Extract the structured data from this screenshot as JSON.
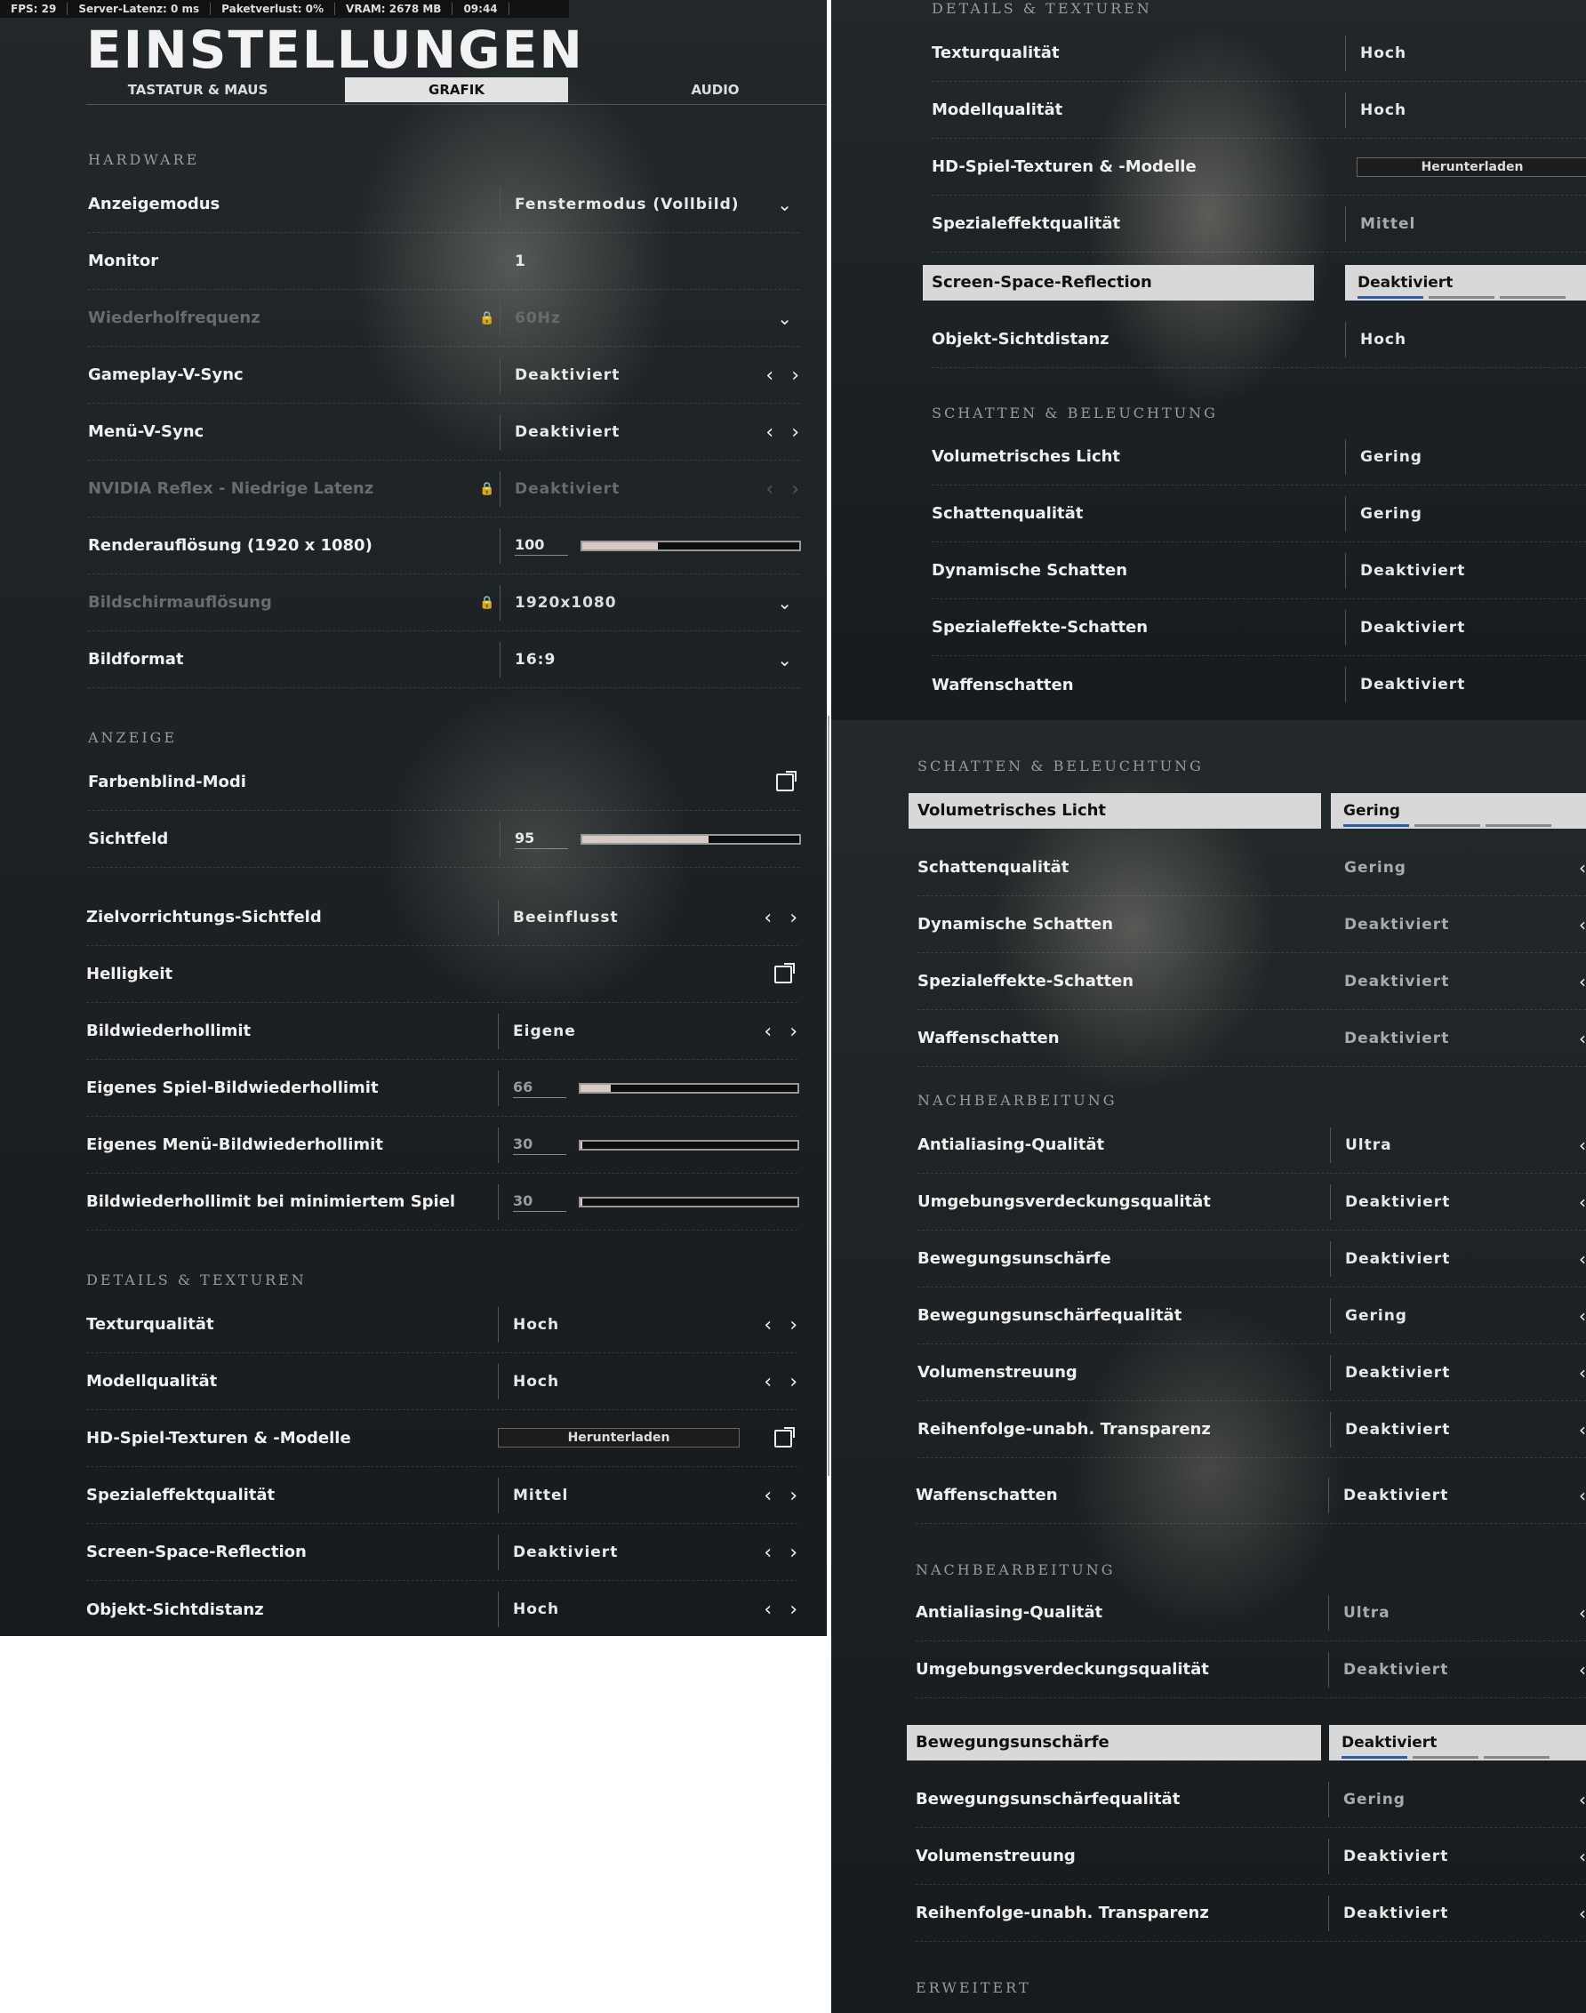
{
  "status": {
    "fps": "FPS: 29",
    "latency": "Server-Latenz: 0 ms",
    "packet": "Paketverlust: 0%",
    "vram": "VRAM: 2678 MB",
    "time": "09:44"
  },
  "header": {
    "title": "EINSTELLUNGEN",
    "tabs": [
      "TASTATUR & MAUS",
      "GRAFIK",
      "AUDIO"
    ],
    "active_tab": "GRAFIK"
  },
  "p1": {
    "hardware": "HARDWARE",
    "anzeigemodus": {
      "label": "Anzeigemodus",
      "value": "Fenstermodus (Vollbild)"
    },
    "monitor": {
      "label": "Monitor",
      "value": "1"
    },
    "wiederholfrequenz": {
      "label": "Wiederholfrequenz",
      "value": "60Hz"
    },
    "gvsync": {
      "label": "Gameplay-V-Sync",
      "value": "Deaktiviert"
    },
    "mvsync": {
      "label": "Menü-V-Sync",
      "value": "Deaktiviert"
    },
    "reflex": {
      "label": "NVIDIA Reflex - Niedrige Latenz",
      "value": "Deaktiviert"
    },
    "render": {
      "label": "Renderauflösung (1920 x 1080)",
      "value": "100",
      "fill": 0.35
    },
    "bildschirm": {
      "label": "Bildschirmauflösung",
      "value": "1920x1080"
    },
    "bildformat": {
      "label": "Bildformat",
      "value": "16:9"
    },
    "anzeige": "ANZEIGE",
    "farbenblind": {
      "label": "Farbenblind-Modi"
    },
    "sichtfeld": {
      "label": "Sichtfeld",
      "value": "95",
      "fill": 0.58
    },
    "ziel": {
      "label": "Zielvorrichtungs-Sichtfeld",
      "value": "Beeinflusst"
    },
    "helligkeit": {
      "label": "Helligkeit"
    },
    "bwl": {
      "label": "Bildwiederhollimit",
      "value": "Eigene"
    },
    "espiel": {
      "label": "Eigenes Spiel-Bildwiederhollimit",
      "value": "66",
      "fill": 0.14
    },
    "emenu": {
      "label": "Eigenes Menü-Bildwiederhollimit",
      "value": "30",
      "fill": 0.01
    },
    "emin": {
      "label": "Bildwiederhollimit bei minimiertem Spiel",
      "value": "30",
      "fill": 0.01
    },
    "details": "DETAILS & TEXTUREN",
    "textur": {
      "label": "Texturqualität",
      "value": "Hoch"
    },
    "modell": {
      "label": "Modellqualität",
      "value": "Hoch"
    },
    "hd": {
      "label": "HD-Spiel-Texturen & -Modelle",
      "value": "Herunterladen"
    },
    "spezial": {
      "label": "Spezialeffektqualität",
      "value": "Mittel"
    },
    "ssr": {
      "label": "Screen-Space-Reflection",
      "value": "Deaktiviert"
    },
    "objekt": {
      "label": "Objekt-Sichtdistanz",
      "value": "Hoch"
    }
  },
  "p2": {
    "details": "DETAILS & TEXTUREN",
    "textur": {
      "label": "Texturqualität",
      "value": "Hoch"
    },
    "modell": {
      "label": "Modellqualität",
      "value": "Hoch"
    },
    "hd": {
      "label": "HD-Spiel-Texturen & -Modelle",
      "value": "Herunterladen"
    },
    "spezial": {
      "label": "Spezialeffektqualität",
      "value": "Mittel"
    },
    "ssr": {
      "label": "Screen-Space-Reflection",
      "value": "Deaktiviert"
    },
    "objekt": {
      "label": "Objekt-Sichtdistanz",
      "value": "Hoch"
    },
    "schatten": "SCHATTEN & BELEUCHTUNG",
    "vol": {
      "label": "Volumetrisches Licht",
      "value": "Gering"
    },
    "sq": {
      "label": "Schattenqualität",
      "value": "Gering"
    },
    "dyn": {
      "label": "Dynamische Schatten",
      "value": "Deaktiviert"
    },
    "spez": {
      "label": "Spezialeffekte-Schatten",
      "value": "Deaktiviert"
    },
    "waffe": {
      "label": "Waffenschatten",
      "value": "Deaktiviert"
    }
  },
  "p3": {
    "schatten": "SCHATTEN & BELEUCHTUNG",
    "vol": {
      "label": "Volumetrisches Licht",
      "value": "Gering"
    },
    "sq": {
      "label": "Schattenqualität",
      "value": "Gering"
    },
    "dyn": {
      "label": "Dynamische Schatten",
      "value": "Deaktiviert"
    },
    "spez": {
      "label": "Spezialeffekte-Schatten",
      "value": "Deaktiviert"
    },
    "waffe": {
      "label": "Waffenschatten",
      "value": "Deaktiviert"
    },
    "nach": "NACHBEARBEITUNG",
    "aa": {
      "label": "Antialiasing-Qualität",
      "value": "Ultra"
    },
    "ao": {
      "label": "Umgebungsverdeckungsqualität",
      "value": "Deaktiviert"
    },
    "mb": {
      "label": "Bewegungsunschärfe",
      "value": "Deaktiviert"
    },
    "mbq": {
      "label": "Bewegungsunschärfequalität",
      "value": "Gering"
    },
    "vs": {
      "label": "Volumenstreuung",
      "value": "Deaktiviert"
    },
    "oit": {
      "label": "Reihenfolge-unabh. Transparenz",
      "value": "Deaktiviert"
    },
    "waffe2": {
      "label": "Waffenschatten",
      "value": "Deaktiviert"
    },
    "nach2": "NACHBEARBEITUNG",
    "aa2": {
      "label": "Antialiasing-Qualität",
      "value": "Ultra"
    },
    "ao2": {
      "label": "Umgebungsverdeckungsqualität",
      "value": "Deaktiviert"
    },
    "mb2": {
      "label": "Bewegungsunschärfe",
      "value": "Deaktiviert"
    },
    "mbq2": {
      "label": "Bewegungsunschärfequalität",
      "value": "Gering"
    },
    "vs2": {
      "label": "Volumenstreuung",
      "value": "Deaktiviert"
    },
    "oit2": {
      "label": "Reihenfolge-unabh. Transparenz",
      "value": "Deaktiviert"
    },
    "erw": "ERWEITERT"
  }
}
